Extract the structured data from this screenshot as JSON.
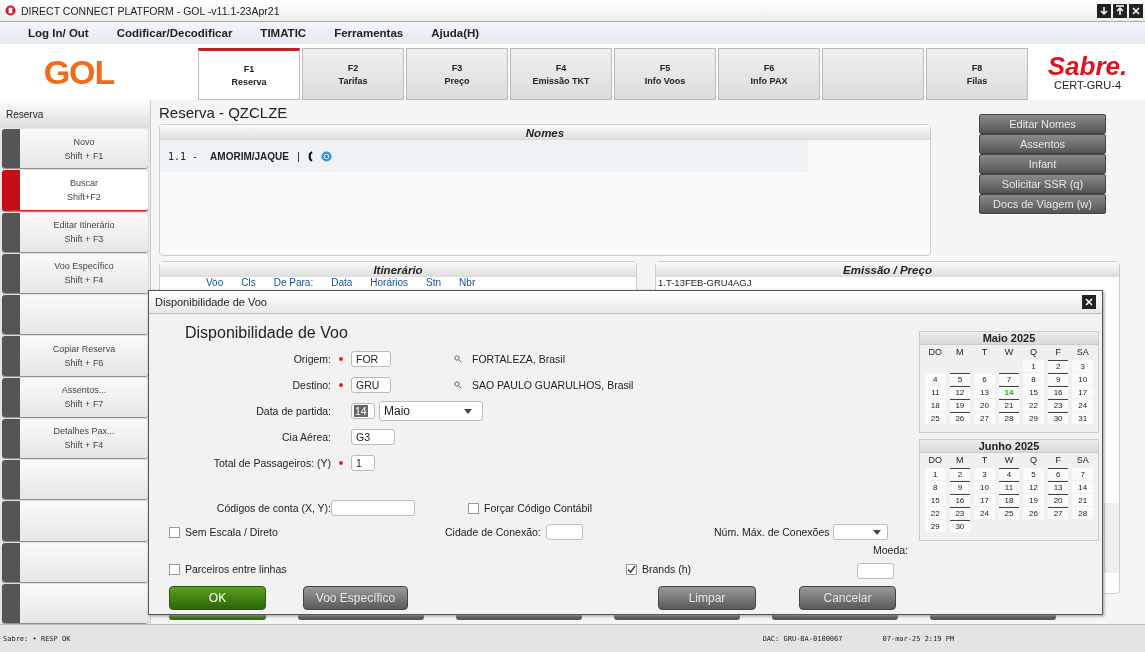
{
  "window": {
    "title": "DIRECT CONNECT PLATFORM - GOL -v11.1-23Apr21"
  },
  "menu": [
    "Log In/ Out",
    "Codificar/Decodificar",
    "TIMATIC",
    "Ferramentas",
    "Ajuda(H)"
  ],
  "logo": {
    "brand": "GOL"
  },
  "tabs": [
    {
      "key": "F1",
      "label": "Reserva",
      "selected": true
    },
    {
      "key": "F2",
      "label": "Tarifas",
      "selected": false
    },
    {
      "key": "F3",
      "label": "Preço",
      "selected": false
    },
    {
      "key": "F4",
      "label": "Emissão TKT",
      "selected": false
    },
    {
      "key": "F5",
      "label": "Info Voos",
      "selected": false
    },
    {
      "key": "F6",
      "label": "Info PAX",
      "selected": false
    },
    {
      "selected": false
    },
    {
      "key": "F8",
      "label": "Filas",
      "selected": false
    }
  ],
  "sabre": {
    "brand": "Sabre.",
    "environment": "CERT-GRU-4"
  },
  "sidebar": {
    "title": "Reserva",
    "items": [
      {
        "label": "Novo",
        "shortcut": "Shift + F1",
        "selected": false
      },
      {
        "label": "Buscar",
        "shortcut": "Shift+F2",
        "selected": true
      },
      {
        "label": "Editar Itinerário",
        "shortcut": "Shift + F3",
        "selected": false
      },
      {
        "label": "Voo Específico",
        "shortcut": "Shift + F4",
        "selected": false
      },
      {
        "selected": false
      },
      {
        "label": "Copiar Reserva",
        "shortcut": "Shift + F6",
        "selected": false
      },
      {
        "label": "Assentos...",
        "shortcut": "Shift + F7",
        "selected": false
      },
      {
        "label": "Detalhes Pax...",
        "shortcut": "Shift + F4",
        "selected": false
      },
      {
        "selected": false
      },
      {
        "selected": false
      },
      {
        "selected": false
      },
      {
        "selected": false
      }
    ]
  },
  "record": {
    "title": "Reserva - QZCLZE"
  },
  "names": {
    "title": "Nomes",
    "passengers": [
      {
        "number": "1.1 -",
        "name": "AMORIM/JAQUE",
        "separator": "|"
      }
    ]
  },
  "actions": [
    "Editar Nomes",
    "Assentos",
    "Infant",
    "Solicitar SSR (q)",
    "Docs de Viagem (w)"
  ],
  "itinerary": {
    "title": "Itinerário",
    "columns": [
      "Voo",
      "Cls",
      "De Para:",
      "Data",
      "Horários",
      "Stn",
      "Nbr"
    ]
  },
  "ticketing": {
    "title": "Emissão / Preço",
    "lines": [
      "1.T-13FEB-GRU4AGJ"
    ]
  },
  "dialog": {
    "title": "Disponibilidade de Voo",
    "heading": "Disponibilidade de Voo",
    "origin": {
      "label": "Origem:",
      "required": true,
      "value": "FOR",
      "lookup": "FORTALEZA, Brasil"
    },
    "destination": {
      "label": "Destino:",
      "required": true,
      "value": "GRU",
      "lookup": "SAO PAULO GUARULHOS, Brasil"
    },
    "departure": {
      "label": "Data de partida:",
      "day": "14",
      "month": "Maio"
    },
    "airline": {
      "label": "Cia Aérea:",
      "value": "G3"
    },
    "passengers": {
      "label": "Total de Passageiros: (Y)",
      "required": true,
      "value": "1"
    },
    "account_codes": {
      "label": "Códigos de conta (X, Y):"
    },
    "force_code": {
      "label": "Forçar Código Contábil",
      "checked": false
    },
    "nonstop": {
      "label": "Sem Escala / Direto",
      "checked": false
    },
    "connection_city": {
      "label": "Cidade de Conexão:"
    },
    "max_connections": {
      "label": "Núm. Máx. de Conexões"
    },
    "currency": {
      "label": "Moeda:"
    },
    "interline": {
      "label": "Parceiros entre linhas",
      "checked": false
    },
    "brands": {
      "label": "Brands (h)",
      "checked": true
    },
    "buttons": [
      {
        "label": "OK",
        "kind": "primary"
      },
      {
        "label": "Voo Específico",
        "kind": "secondary"
      },
      {
        "label": "Limpar",
        "kind": "secondary"
      },
      {
        "label": "Cancelar",
        "kind": "secondary"
      }
    ],
    "calendars": [
      {
        "title": "Maio 2025",
        "weekdays": [
          "DO",
          "M",
          "T",
          "W",
          "Q",
          "F",
          "SA"
        ],
        "weeks": [
          [
            {
              "kind": "blank"
            },
            {
              "kind": "blank"
            },
            {
              "kind": "blank"
            },
            {
              "kind": "blank"
            },
            {
              "day": "1",
              "marked": false,
              "selected": false
            },
            {
              "day": "2",
              "marked": true,
              "selected": false
            },
            {
              "day": "3",
              "marked": false,
              "selected": false
            }
          ],
          [
            {
              "day": "4",
              "marked": false,
              "selected": false
            },
            {
              "day": "5",
              "marked": true,
              "selected": false
            },
            {
              "day": "6",
              "marked": false,
              "selected": false
            },
            {
              "day": "7",
              "marked": true,
              "selected": false
            },
            {
              "day": "8",
              "marked": false,
              "selected": false
            },
            {
              "day": "9",
              "marked": true,
              "selected": false
            },
            {
              "day": "10",
              "marked": false,
              "selected": false
            }
          ],
          [
            {
              "day": "11",
              "marked": false,
              "selected": false
            },
            {
              "day": "12",
              "marked": true,
              "selected": false
            },
            {
              "day": "13",
              "marked": false,
              "selected": false
            },
            {
              "day": "14",
              "marked": true,
              "selected": true
            },
            {
              "day": "15",
              "marked": false,
              "selected": false
            },
            {
              "day": "16",
              "marked": true,
              "selected": false
            },
            {
              "day": "17",
              "marked": false,
              "selected": false
            }
          ],
          [
            {
              "day": "18",
              "marked": false,
              "selected": false
            },
            {
              "day": "19",
              "marked": true,
              "selected": false
            },
            {
              "day": "20",
              "marked": false,
              "selected": false
            },
            {
              "day": "21",
              "marked": true,
              "selected": false
            },
            {
              "day": "22",
              "marked": false,
              "selected": false
            },
            {
              "day": "23",
              "marked": true,
              "selected": false
            },
            {
              "day": "24",
              "marked": false,
              "selected": false
            }
          ],
          [
            {
              "day": "25",
              "marked": false,
              "selected": false
            },
            {
              "day": "26",
              "marked": true,
              "selected": false
            },
            {
              "day": "27",
              "marked": false,
              "selected": false
            },
            {
              "day": "28",
              "marked": true,
              "selected": false
            },
            {
              "day": "29",
              "marked": false,
              "selected": false
            },
            {
              "day": "30",
              "marked": true,
              "selected": false
            },
            {
              "day": "31",
              "marked": false,
              "selected": false
            }
          ]
        ]
      },
      {
        "title": "Junho 2025",
        "weekdays": [
          "DO",
          "M",
          "T",
          "W",
          "Q",
          "F",
          "SA"
        ],
        "weeks": [
          [
            {
              "day": "1",
              "marked": false,
              "selected": false
            },
            {
              "day": "2",
              "marked": true,
              "selected": false
            },
            {
              "day": "3",
              "marked": false,
              "selected": false
            },
            {
              "day": "4",
              "marked": true,
              "selected": false
            },
            {
              "day": "5",
              "marked": false,
              "selected": false
            },
            {
              "day": "6",
              "marked": true,
              "selected": false
            },
            {
              "day": "7",
              "marked": false,
              "selected": false
            }
          ],
          [
            {
              "day": "8",
              "marked": false,
              "selected": false
            },
            {
              "day": "9",
              "marked": true,
              "selected": false
            },
            {
              "day": "10",
              "marked": false,
              "selected": false
            },
            {
              "day": "11",
              "marked": true,
              "selected": false
            },
            {
              "day": "12",
              "marked": false,
              "selected": false
            },
            {
              "day": "13",
              "marked": true,
              "selected": false
            },
            {
              "day": "14",
              "marked": false,
              "selected": false
            }
          ],
          [
            {
              "day": "15",
              "marked": false,
              "selected": false
            },
            {
              "day": "16",
              "marked": true,
              "selected": false
            },
            {
              "day": "17",
              "marked": false,
              "selected": false
            },
            {
              "day": "18",
              "marked": true,
              "selected": false
            },
            {
              "day": "19",
              "marked": false,
              "selected": false
            },
            {
              "day": "20",
              "marked": true,
              "selected": false
            },
            {
              "day": "21",
              "marked": false,
              "selected": false
            }
          ],
          [
            {
              "day": "22",
              "marked": false,
              "selected": false
            },
            {
              "day": "23",
              "marked": true,
              "selected": false
            },
            {
              "day": "24",
              "marked": false,
              "selected": false
            },
            {
              "day": "25",
              "marked": true,
              "selected": false
            },
            {
              "day": "26",
              "marked": false,
              "selected": false
            },
            {
              "day": "27",
              "marked": true,
              "selected": false
            },
            {
              "day": "28",
              "marked": false,
              "selected": false
            }
          ],
          [
            {
              "day": "29",
              "marked": false,
              "selected": false
            },
            {
              "day": "30",
              "marked": true,
              "selected": false
            }
          ]
        ]
      }
    ]
  },
  "status_bar": {
    "status": "Sabre: • RESP OK",
    "office": "OAC: GRU-BA-0100067",
    "datetime": "07-mar-25 2:19 PM"
  }
}
